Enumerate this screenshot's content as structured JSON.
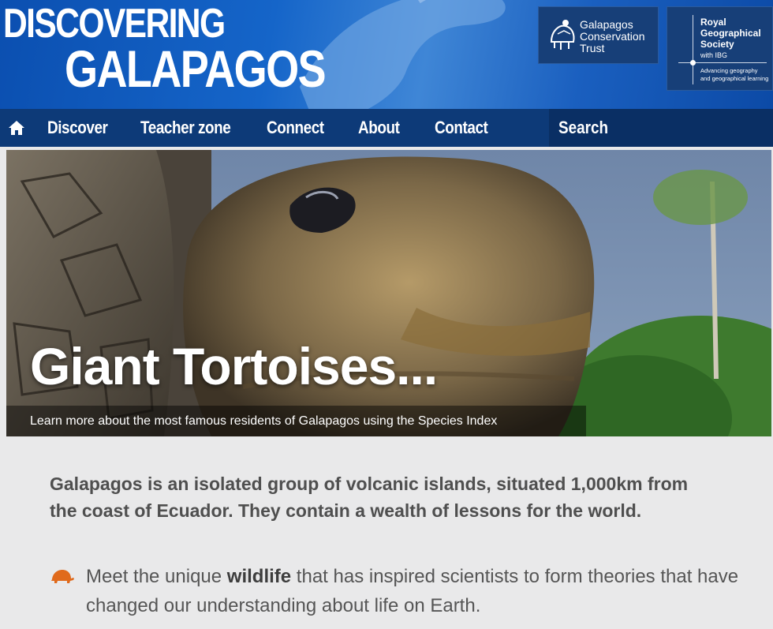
{
  "header": {
    "logo_line1": "DISCOVERING",
    "logo_line2": "GALAPAGOS",
    "partner1": {
      "lines": [
        "Galapagos",
        "Conservation",
        "Trust"
      ]
    },
    "partner2": {
      "title_lines": [
        "Royal",
        "Geographical",
        "Society"
      ],
      "with": "with IBG",
      "tagline_lines": [
        "Advancing geography",
        "and geographical learning"
      ]
    }
  },
  "nav": {
    "items": [
      "Discover",
      "Teacher zone",
      "Connect",
      "About",
      "Contact"
    ],
    "search": "Search"
  },
  "hero": {
    "title": "Giant Tortoises...",
    "caption": "Learn more about the most famous residents of Galapagos using the Species Index"
  },
  "content": {
    "lead": "Galapagos is an isolated group of volcanic islands, situated 1,000km from the coast of Ecuador. They contain a wealth of lessons for the world.",
    "bullet_pre": "Meet the unique ",
    "bullet_bold": "wildlife",
    "bullet_post": " that has inspired scientists to form theories that have changed our understanding about life on Earth."
  },
  "colors": {
    "header_blue": "#1565c9",
    "nav_blue": "#0d3a78",
    "tortoise_icon": "#e06a1c"
  }
}
